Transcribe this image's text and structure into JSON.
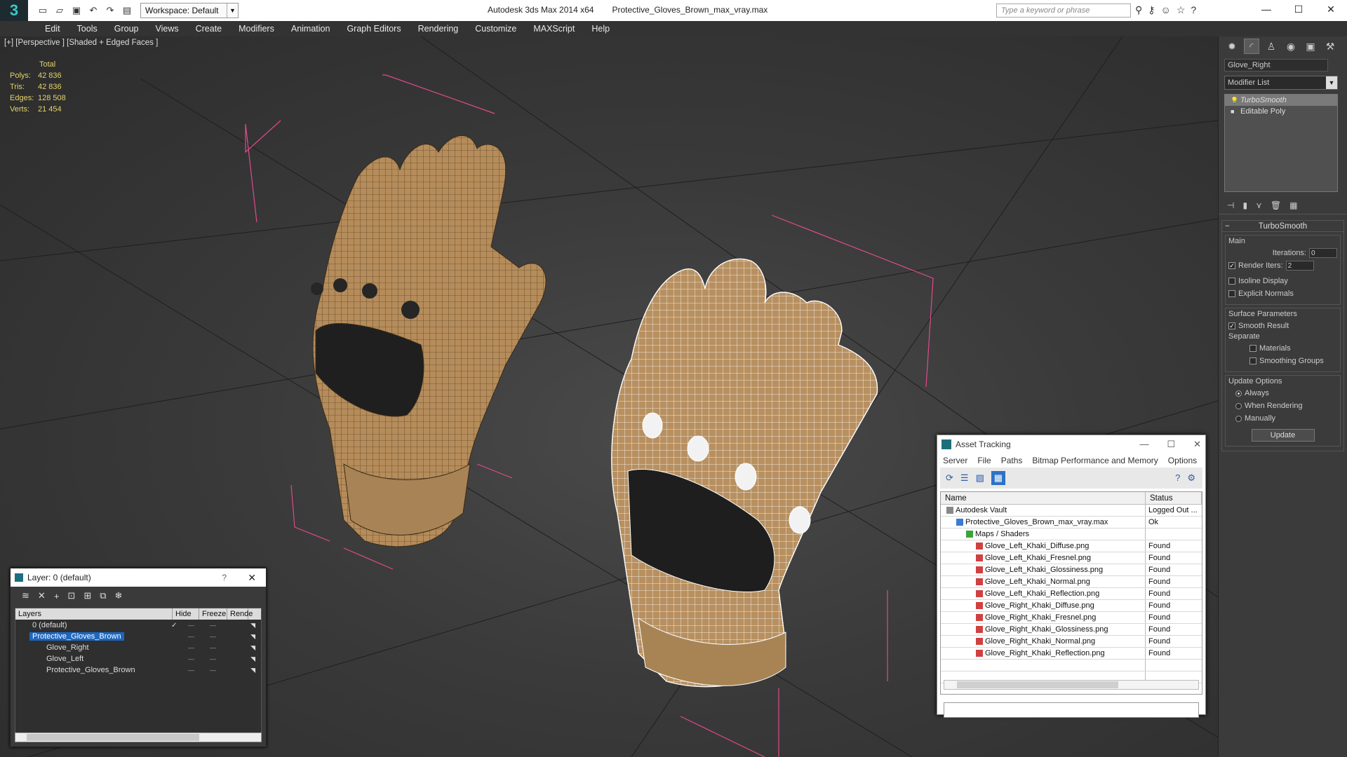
{
  "app": {
    "title": "Autodesk 3ds Max 2014 x64",
    "file": "Protective_Gloves_Brown_max_vray.max",
    "workspace": "Workspace: Default",
    "search_placeholder": "Type a keyword or phrase"
  },
  "menu": [
    "Edit",
    "Tools",
    "Group",
    "Views",
    "Create",
    "Modifiers",
    "Animation",
    "Graph Editors",
    "Rendering",
    "Customize",
    "MAXScript",
    "Help"
  ],
  "viewport": {
    "label": "[+] [Perspective ] [Shaded + Edged Faces ]",
    "stats_header": "Total",
    "stats": [
      {
        "k": "Polys:",
        "v": "42 836"
      },
      {
        "k": "Tris:",
        "v": "42 836"
      },
      {
        "k": "Edges:",
        "v": "128 508"
      },
      {
        "k": "Verts:",
        "v": "21 454"
      }
    ]
  },
  "command_panel": {
    "object_name": "Glove_Right",
    "modifier_list": "Modifier List",
    "stack": [
      "TurboSmooth",
      "Editable Poly"
    ],
    "rollout_title": "TurboSmooth",
    "main_label": "Main",
    "iterations_label": "Iterations:",
    "iterations": "0",
    "render_iters_label": "Render Iters:",
    "render_iters": "2",
    "isoline": "Isoline Display",
    "explicit_normals": "Explicit Normals",
    "surface_params": "Surface Parameters",
    "smooth_result": "Smooth Result",
    "separate": "Separate",
    "materials": "Materials",
    "smoothing_groups": "Smoothing Groups",
    "update_options": "Update Options",
    "always": "Always",
    "when_rendering": "When Rendering",
    "manually": "Manually",
    "update_btn": "Update"
  },
  "layer_window": {
    "title": "Layer: 0 (default)",
    "help": "?",
    "columns": [
      "Layers",
      "Hide",
      "Freeze",
      "Rende"
    ],
    "rows": [
      {
        "name": "0 (default)",
        "level": 0
      },
      {
        "name": "Protective_Gloves_Brown",
        "level": 0,
        "selected": true
      },
      {
        "name": "Glove_Right",
        "level": 1
      },
      {
        "name": "Glove_Left",
        "level": 1
      },
      {
        "name": "Protective_Gloves_Brown",
        "level": 1
      }
    ]
  },
  "asset_tracking": {
    "title": "Asset Tracking",
    "menu": [
      "Server",
      "File",
      "Paths",
      "Bitmap Performance and Memory",
      "Options"
    ],
    "columns": [
      "Name",
      "Status"
    ],
    "rows": [
      {
        "name": "Autodesk Vault",
        "status": "Logged Out ...",
        "level": 0,
        "color": "#888888"
      },
      {
        "name": "Protective_Gloves_Brown_max_vray.max",
        "status": "Ok",
        "level": 1,
        "color": "#3a7bd5"
      },
      {
        "name": "Maps / Shaders",
        "status": "",
        "level": 2,
        "color": "#3aa43a"
      },
      {
        "name": "Glove_Left_Khaki_Diffuse.png",
        "status": "Found",
        "level": 3,
        "color": "#d04040"
      },
      {
        "name": "Glove_Left_Khaki_Fresnel.png",
        "status": "Found",
        "level": 3,
        "color": "#d04040"
      },
      {
        "name": "Glove_Left_Khaki_Glossiness.png",
        "status": "Found",
        "level": 3,
        "color": "#d04040"
      },
      {
        "name": "Glove_Left_Khaki_Normal.png",
        "status": "Found",
        "level": 3,
        "color": "#d04040"
      },
      {
        "name": "Glove_Left_Khaki_Reflection.png",
        "status": "Found",
        "level": 3,
        "color": "#d04040"
      },
      {
        "name": "Glove_Right_Khaki_Diffuse.png",
        "status": "Found",
        "level": 3,
        "color": "#d04040"
      },
      {
        "name": "Glove_Right_Khaki_Fresnel.png",
        "status": "Found",
        "level": 3,
        "color": "#d04040"
      },
      {
        "name": "Glove_Right_Khaki_Glossiness.png",
        "status": "Found",
        "level": 3,
        "color": "#d04040"
      },
      {
        "name": "Glove_Right_Khaki_Normal.png",
        "status": "Found",
        "level": 3,
        "color": "#d04040"
      },
      {
        "name": "Glove_Right_Khaki_Reflection.png",
        "status": "Found",
        "level": 3,
        "color": "#d04040"
      }
    ]
  }
}
